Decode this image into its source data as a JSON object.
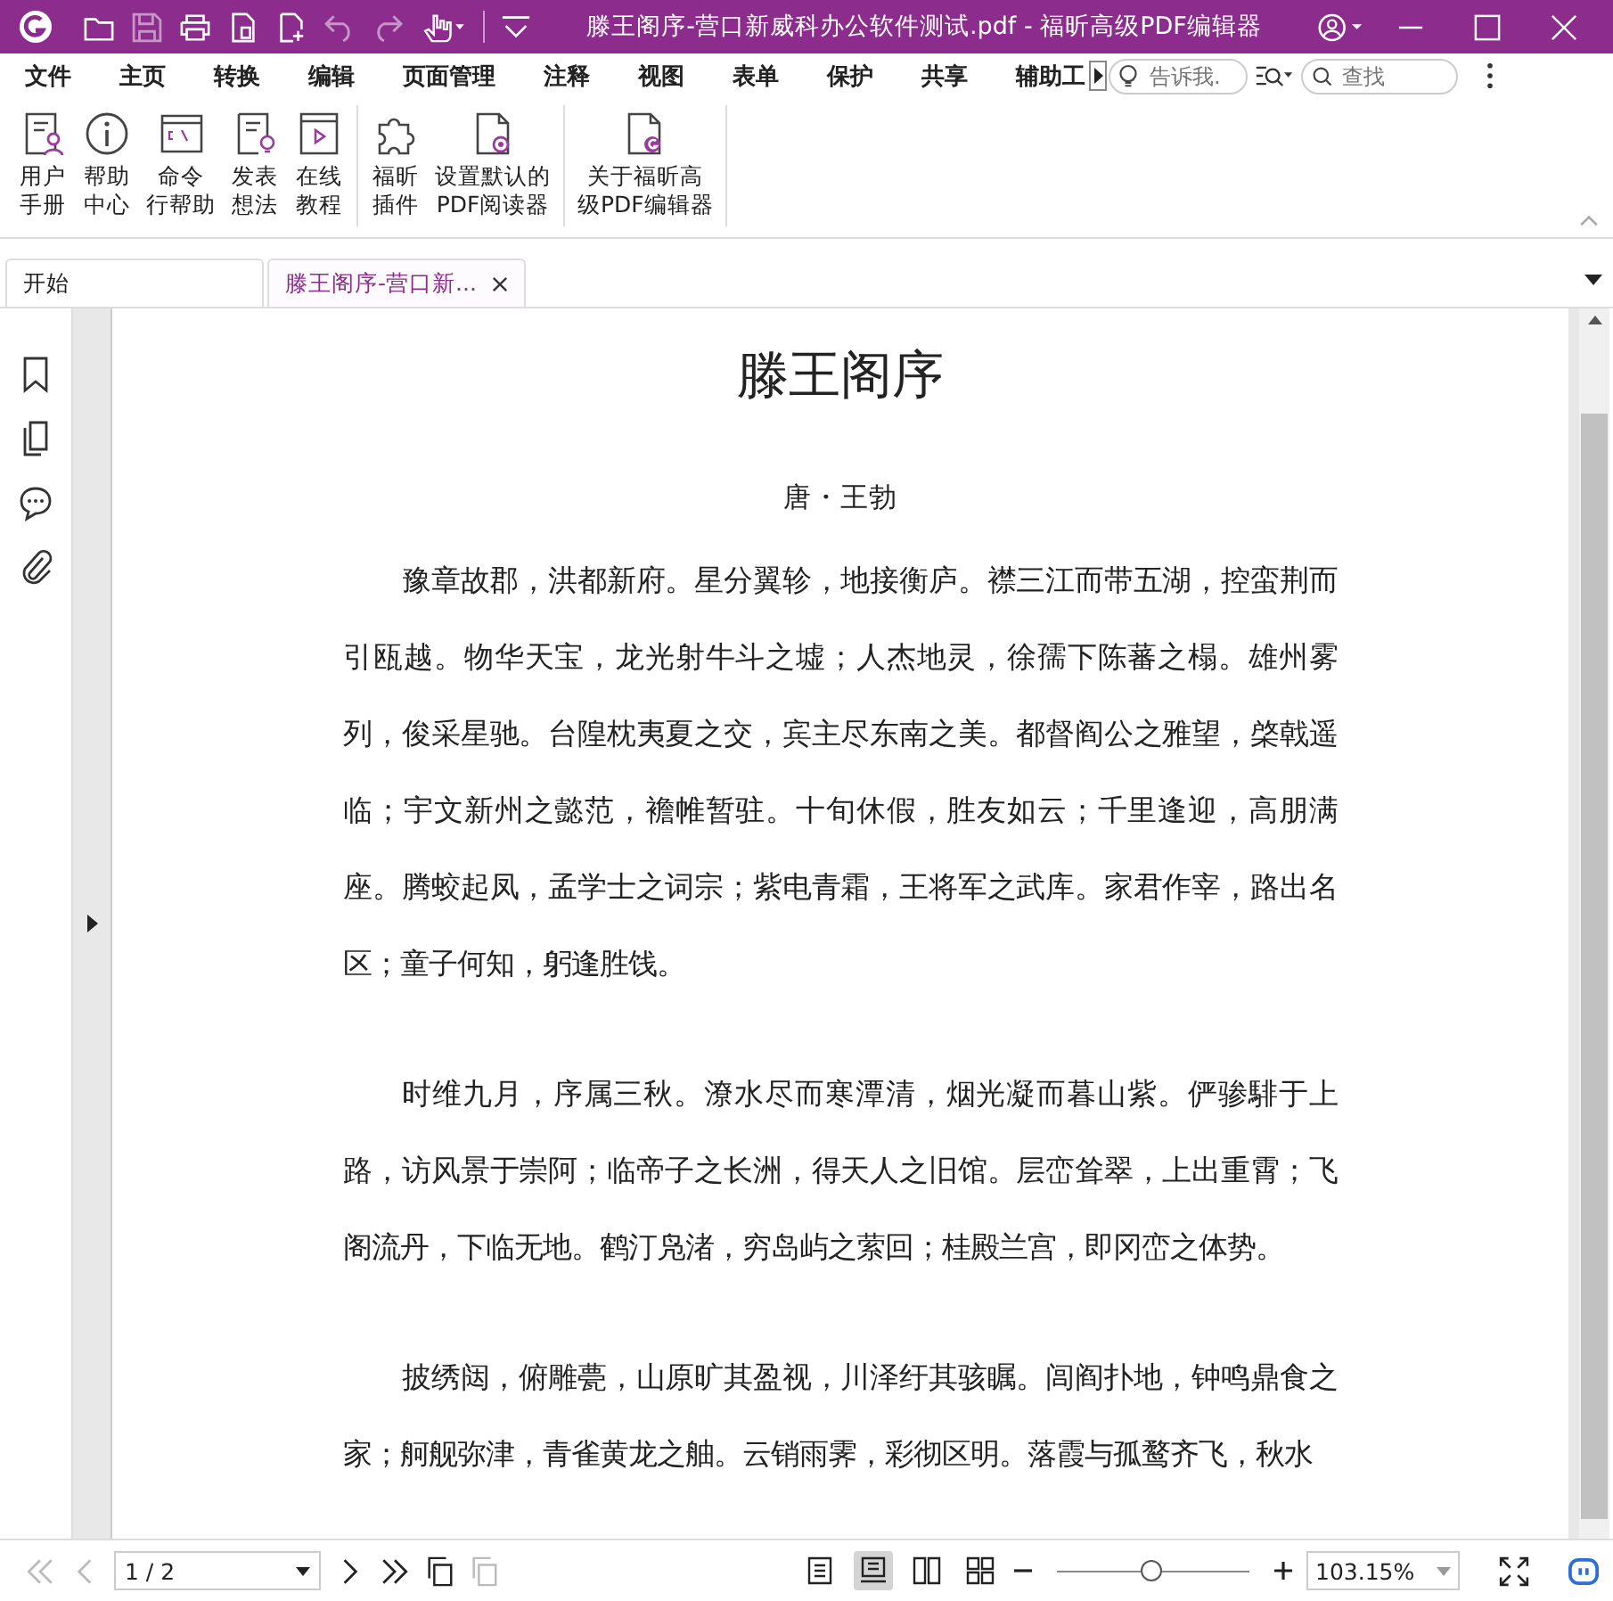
{
  "window": {
    "title": "滕王阁序-营口新威科办公软件测试.pdf - 福昕高级PDF编辑器"
  },
  "menu": [
    {
      "label": "文件"
    },
    {
      "label": "主页"
    },
    {
      "label": "转换"
    },
    {
      "label": "编辑"
    },
    {
      "label": "页面管理"
    },
    {
      "label": "注释"
    },
    {
      "label": "视图"
    },
    {
      "label": "表单"
    },
    {
      "label": "保护"
    },
    {
      "label": "共享"
    },
    {
      "label": "辅助工"
    }
  ],
  "tell_me": {
    "placeholder": "告诉我."
  },
  "search": {
    "placeholder": "查找"
  },
  "ribbon_groups": [
    {
      "items": [
        {
          "lines": [
            "用户",
            "手册"
          ],
          "kind": "manual"
        },
        {
          "lines": [
            "帮助",
            "中心"
          ],
          "kind": "info"
        },
        {
          "lines": [
            "命令",
            "行帮助"
          ],
          "kind": "cmd"
        },
        {
          "lines": [
            "发表",
            "想法"
          ],
          "kind": "idea"
        },
        {
          "lines": [
            "在线",
            "教程"
          ],
          "kind": "video"
        }
      ]
    },
    {
      "items": [
        {
          "lines": [
            "福昕",
            "插件"
          ],
          "kind": "puzzle"
        },
        {
          "lines": [
            "设置默认的",
            "PDF阅读器"
          ],
          "kind": "default"
        }
      ]
    },
    {
      "items": [
        {
          "lines": [
            "关于福昕高",
            "级PDF编辑器"
          ],
          "kind": "about"
        }
      ]
    }
  ],
  "doc_tabs": [
    {
      "label": "开始",
      "selected": false
    },
    {
      "label": "滕王阁序-营口新...",
      "selected": true
    }
  ],
  "document": {
    "title": "滕王阁序",
    "author": "唐・王勃",
    "paragraphs": [
      "豫章故郡，洪都新府。星分翼轸，地接衡庐。襟三江而带五湖，控蛮荆而引瓯越。物华天宝，龙光射牛斗之墟；人杰地灵，徐孺下陈蕃之榻。雄州雾列，俊采星驰。台隍枕夷夏之交，宾主尽东南之美。都督阎公之雅望，棨戟遥临；宇文新州之懿范，襜帷暂驻。十旬休假，胜友如云；千里逢迎，高朋满座。腾蛟起凤，孟学士之词宗；紫电青霜，王将军之武库。家君作宰，路出名区；童子何知，躬逢胜饯。",
      "时维九月，序属三秋。潦水尽而寒潭清，烟光凝而暮山紫。俨骖騑于上路，访风景于崇阿；临帝子之长洲，得天人之旧馆。层峦耸翠，上出重霄；飞阁流丹，下临无地。鹤汀凫渚，穷岛屿之萦回；桂殿兰宫，即冈峦之体势。",
      "披绣闼，俯雕甍，山原旷其盈视，川泽纡其骇瞩。闾阎扑地，钟鸣鼎食之家；舸舰弥津，青雀黄龙之舳。云销雨霁，彩彻区明。落霞与孤鹜齐飞，秋水"
    ]
  },
  "status_bar": {
    "page": "1 / 2",
    "views": [
      {
        "selected": false
      },
      {
        "selected": true
      },
      {
        "selected": false
      },
      {
        "selected": false
      }
    ],
    "zoom_slider": {
      "level": 0.49
    },
    "zoom": "103.15%"
  }
}
